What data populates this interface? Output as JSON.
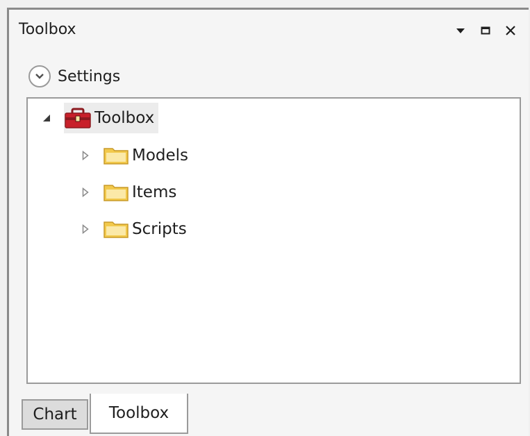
{
  "panel": {
    "title": "Toolbox",
    "buttons": [
      {
        "name": "dropdown",
        "icon": "chevron-down-icon"
      },
      {
        "name": "maximize",
        "icon": "maximize-icon"
      },
      {
        "name": "close",
        "icon": "close-icon"
      }
    ]
  },
  "settings": {
    "label": "Settings",
    "icon": "chevron-down-icon"
  },
  "tree": {
    "root": {
      "label": "Toolbox",
      "icon": "toolbox-icon",
      "expanded": true
    },
    "children": [
      {
        "label": "Models",
        "icon": "folder-icon",
        "expanded": false
      },
      {
        "label": "Items",
        "icon": "folder-icon",
        "expanded": false
      },
      {
        "label": "Scripts",
        "icon": "folder-icon",
        "expanded": false
      }
    ]
  },
  "tabs": [
    {
      "label": "Chart",
      "active": false
    },
    {
      "label": "Toolbox",
      "active": true
    }
  ],
  "colors": {
    "toolbox_red": "#c8202a",
    "folder_yellow": "#f2c94c",
    "border": "#9a9a9a"
  }
}
